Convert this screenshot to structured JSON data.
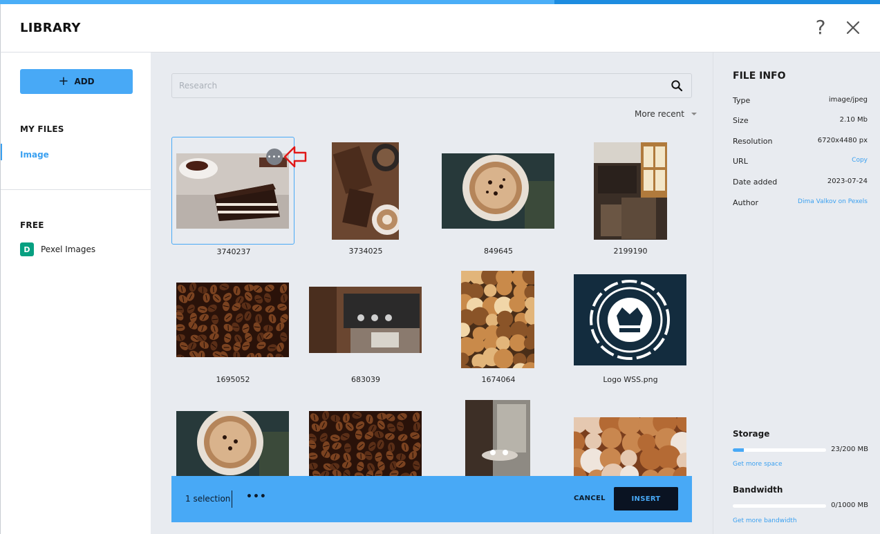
{
  "header": {
    "title": "LIBRARY",
    "help_glyph": "?"
  },
  "progress": {
    "fraction": 0.63
  },
  "sidebar": {
    "add_label": "ADD",
    "my_files_heading": "MY FILES",
    "my_files_items": [
      {
        "label": "Image",
        "active": true
      }
    ],
    "free_heading": "FREE",
    "free_items": [
      {
        "label": "Pexel Images",
        "icon": "pexels-logo-icon",
        "icon_letter": "D"
      }
    ]
  },
  "search": {
    "placeholder": "Research",
    "value": ""
  },
  "sort": {
    "label": "More recent"
  },
  "tiles": [
    {
      "caption": "3740237",
      "selected": true,
      "photo": "chocolate-cake-photo"
    },
    {
      "caption": "3734025",
      "selected": false,
      "photo": "coffee-brownies-photo"
    },
    {
      "caption": "849645",
      "selected": false,
      "photo": "cappuccino-photo"
    },
    {
      "caption": "2199190",
      "selected": false,
      "photo": "cafe-interior-photo"
    },
    {
      "caption": "1695052",
      "selected": false,
      "photo": "coffee-beans-photo"
    },
    {
      "caption": "683039",
      "selected": false,
      "photo": "coffee-bar-photo"
    },
    {
      "caption": "1674064",
      "selected": false,
      "photo": "pastries-photo"
    },
    {
      "caption": "Logo WSS.png",
      "selected": false,
      "photo": "crown-logo-image"
    },
    {
      "caption": "",
      "selected": false,
      "photo": "cappuccino-photo"
    },
    {
      "caption": "",
      "selected": false,
      "photo": "coffee-beans-photo"
    },
    {
      "caption": "",
      "selected": false,
      "photo": "cafe-window-photo"
    },
    {
      "caption": "",
      "selected": false,
      "photo": "donuts-photo"
    }
  ],
  "selection_bar": {
    "count_label": "1 selection",
    "more_glyph": "•••",
    "cancel_label": "CANCEL",
    "insert_label": "INSERT"
  },
  "file_info": {
    "heading": "FILE INFO",
    "rows": [
      {
        "key": "Type",
        "value": "image/jpeg",
        "link": false
      },
      {
        "key": "Size",
        "value": "2.10 Mb",
        "link": false
      },
      {
        "key": "Resolution",
        "value": "6720x4480 px",
        "link": false
      },
      {
        "key": "URL",
        "value": "Copy",
        "link": true
      },
      {
        "key": "Date added",
        "value": "2023-07-24",
        "link": false
      },
      {
        "key": "Author",
        "value": "Dima Valkov on Pexels",
        "link": true
      }
    ]
  },
  "storage": {
    "heading": "Storage",
    "used_fraction": 0.115,
    "value": "23/200 MB",
    "more_label": "Get more space"
  },
  "bandwidth": {
    "heading": "Bandwidth",
    "used_fraction": 0.0,
    "value": "0/1000 MB",
    "more_label": "Get more bandwidth"
  },
  "colors": {
    "accent": "#48a9f6",
    "dark": "#0a1322",
    "panel": "#e8ebf0",
    "annotation": "#e01818"
  }
}
